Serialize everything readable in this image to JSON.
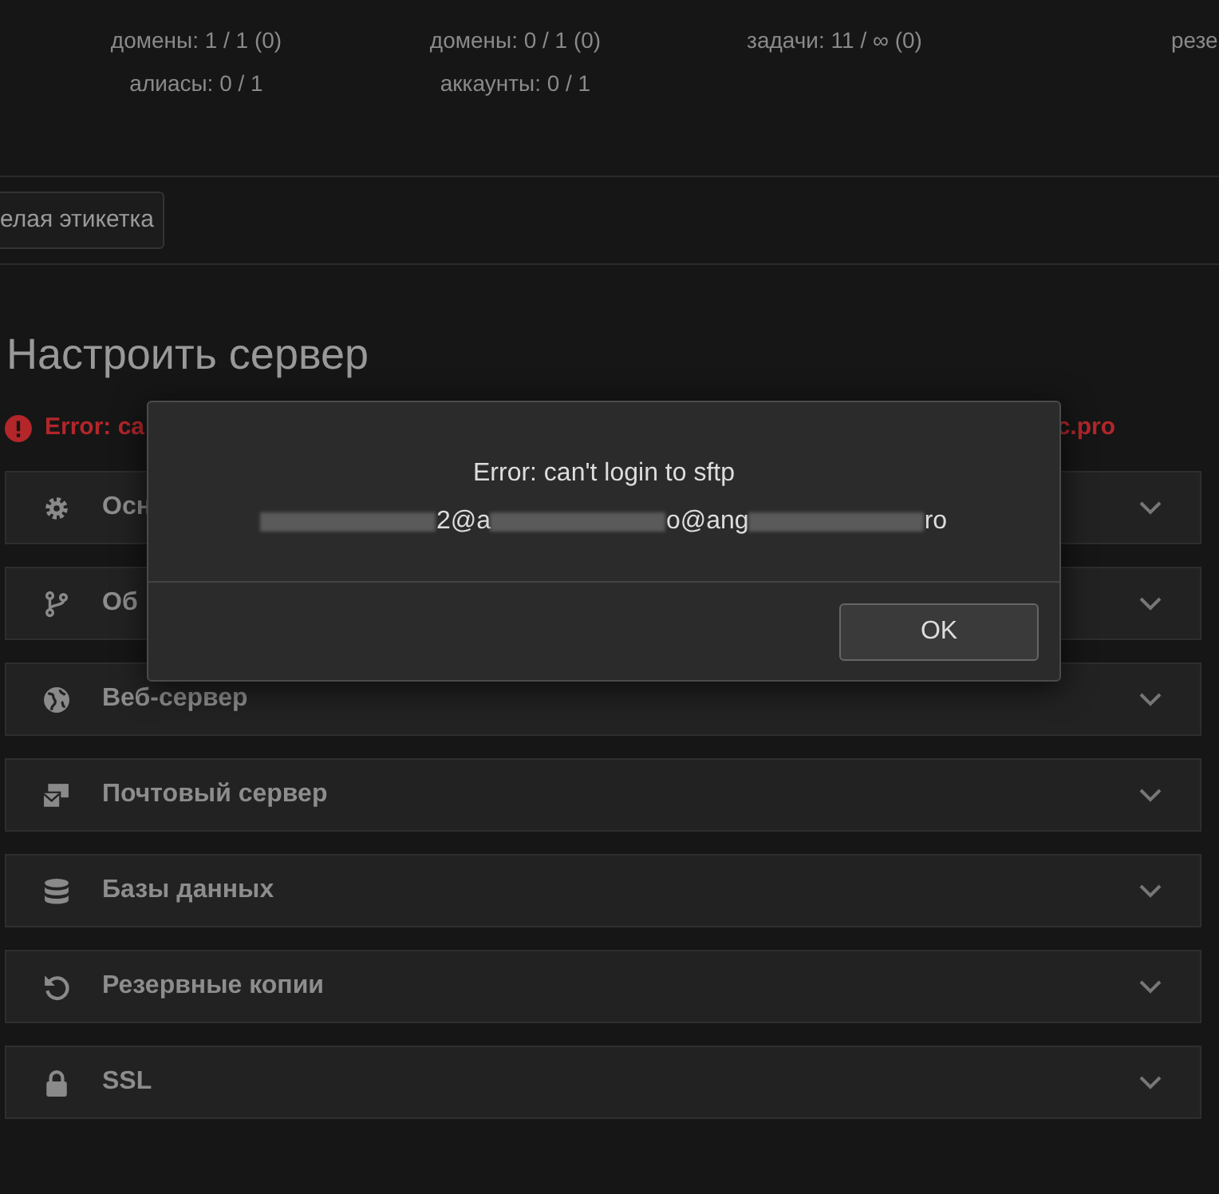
{
  "stats": [
    {
      "lines": [
        "домены: 1 / 1 (0)",
        "алиасы: 0 / 1"
      ]
    },
    {
      "lines": [
        "домены: 0 / 1 (0)",
        "аккаунты: 0 / 1"
      ]
    },
    {
      "lines": [
        "задачи: 11 / ∞ (0)"
      ]
    },
    {
      "lines": [
        "резе"
      ]
    }
  ],
  "label_button": "елая этикетка",
  "heading": "Настроить сервер",
  "error_line": {
    "left": "Error: ca",
    "right": "c.pro"
  },
  "sections": [
    {
      "title": "Осн",
      "expanded": false
    },
    {
      "title": "Об",
      "expanded": false
    },
    {
      "title": "Веб-сервер",
      "expanded": false
    },
    {
      "title": "Почтовый сервер",
      "expanded": false
    },
    {
      "title": "Базы данных",
      "expanded": false
    },
    {
      "title": "Резервные копии",
      "expanded": false
    },
    {
      "title": "SSL",
      "expanded": false
    }
  ],
  "dialog": {
    "message": "Error: can't login to sftp",
    "detail": [
      {
        "kind": "redacted"
      },
      {
        "kind": "text",
        "text": "2@a"
      },
      {
        "kind": "redacted"
      },
      {
        "kind": "text",
        "text": "o@ang"
      },
      {
        "kind": "redacted"
      },
      {
        "kind": "text",
        "text": "ro"
      }
    ],
    "buttons": [
      "OK"
    ]
  }
}
